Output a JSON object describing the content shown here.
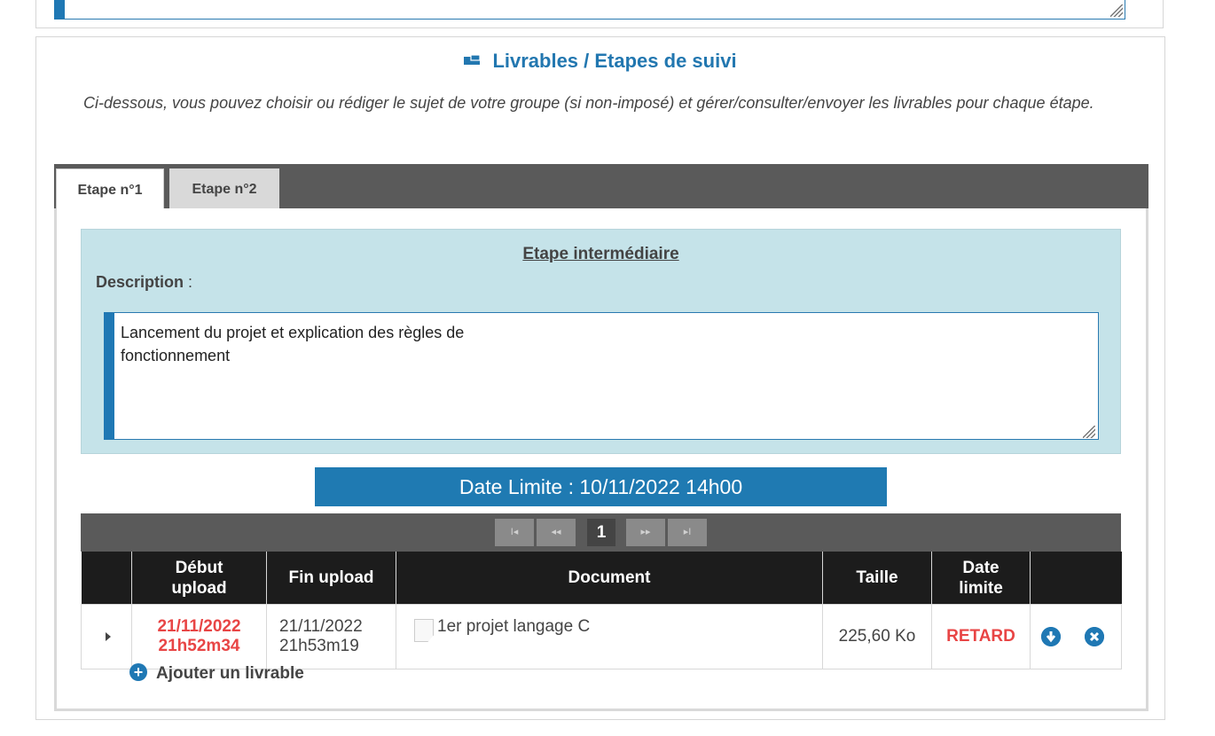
{
  "header": {
    "title": "Livrables / Etapes de suivi",
    "icon": "card-icon",
    "intro": "Ci-dessous, vous pouvez choisir ou rédiger le sujet de votre groupe (si non-imposé) et gérer/consulter/envoyer les livrables pour chaque étape."
  },
  "tabs": [
    {
      "label": "Etape n°1",
      "active": true
    },
    {
      "label": "Etape n°2",
      "active": false
    }
  ],
  "step": {
    "title": "Etape intermédiaire",
    "description_label": "Description",
    "description_sep": " :",
    "description_text": "Lancement du projet et explication des règles de\nfonctionnement"
  },
  "deadline": {
    "text": "Date Limite : 10/11/2022 14h00"
  },
  "pager": {
    "first": "I◂",
    "prev": "◂◂",
    "current": "1",
    "next": "▸▸",
    "last": "▸I"
  },
  "table": {
    "headers": {
      "start": "Début upload",
      "end": "Fin upload",
      "document": "Document",
      "size": "Taille",
      "deadline": "Date limite"
    },
    "rows": [
      {
        "start_date": "21/11/2022",
        "start_time": "21h52m34",
        "end_date": "21/11/2022",
        "end_time": "21h53m19",
        "document": "1er projet langage C",
        "size": "225,60 Ko",
        "status": "RETARD"
      }
    ]
  },
  "add_deliverable": "Ajouter un livrable",
  "colors": {
    "accent": "#1f78b4",
    "late": "#e84545",
    "header_bg": "#1c1c1c",
    "step_bg": "#c5e3e9"
  }
}
